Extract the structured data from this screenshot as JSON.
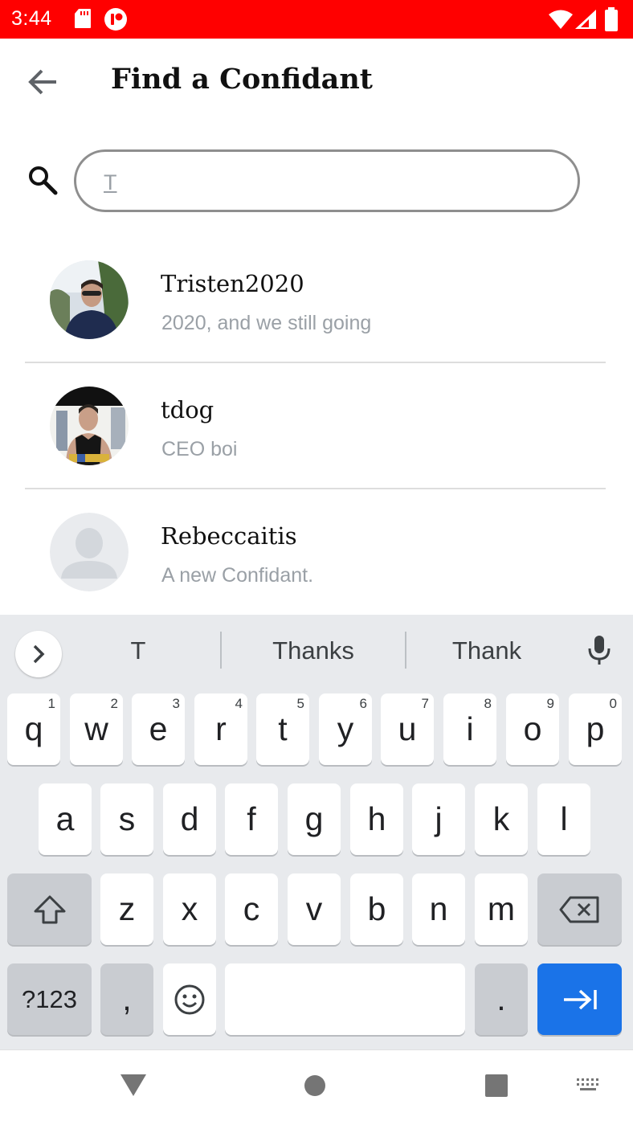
{
  "status_bar": {
    "time": "3:44",
    "background_color": "#ff0000",
    "left_icons": [
      "sd-card-icon",
      "notification-app-icon"
    ],
    "right_icons": [
      "wifi-icon",
      "signal-icon",
      "battery-icon"
    ]
  },
  "header": {
    "title": "Find a Confidant",
    "back_icon": "arrow-back-icon"
  },
  "search": {
    "value": "T",
    "icon": "search-icon"
  },
  "contacts": [
    {
      "name": "Tristen2020",
      "status": "2020, and we still going",
      "avatar": "photo"
    },
    {
      "name": "tdog",
      "status": "CEO boi",
      "avatar": "photo"
    },
    {
      "name": "Rebeccaitis",
      "status": "A new Confidant.",
      "avatar": "placeholder"
    }
  ],
  "keyboard": {
    "suggestions": [
      "T",
      "Thanks",
      "Thank"
    ],
    "row1": [
      {
        "label": "q",
        "hint": "1"
      },
      {
        "label": "w",
        "hint": "2"
      },
      {
        "label": "e",
        "hint": "3"
      },
      {
        "label": "r",
        "hint": "4"
      },
      {
        "label": "t",
        "hint": "5"
      },
      {
        "label": "y",
        "hint": "6"
      },
      {
        "label": "u",
        "hint": "7"
      },
      {
        "label": "i",
        "hint": "8"
      },
      {
        "label": "o",
        "hint": "9"
      },
      {
        "label": "p",
        "hint": "0"
      }
    ],
    "row2": [
      "a",
      "s",
      "d",
      "f",
      "g",
      "h",
      "j",
      "k",
      "l"
    ],
    "row3": [
      "z",
      "x",
      "c",
      "v",
      "b",
      "n",
      "m"
    ],
    "symbols_label": "?123",
    "comma_label": ",",
    "period_label": ".",
    "enter_color": "#1a73e8"
  },
  "nav_bar": {
    "icons": [
      "back-triangle-icon",
      "home-circle-icon",
      "recents-square-icon",
      "keyboard-switch-icon"
    ]
  }
}
